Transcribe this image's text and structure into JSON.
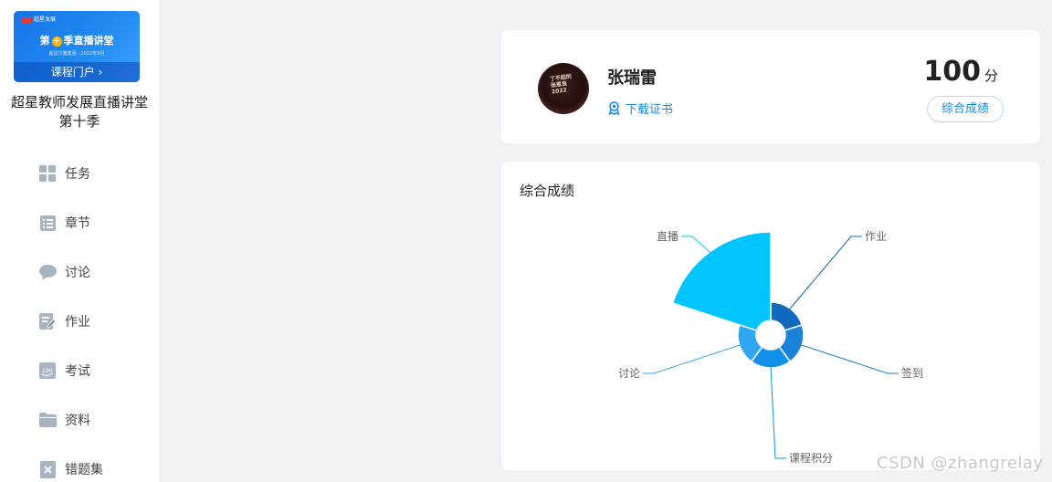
{
  "sidebar": {
    "banner": {
      "logo_text": "超星发展",
      "title_pre": "第",
      "title_num": "十",
      "title_post": "季直播讲堂",
      "subtitle": "超星尔雅集团 · 2022年9月",
      "portal_label": "课程门户 ›"
    },
    "course_title": "超星教师发展直播讲堂 第十季",
    "items": [
      {
        "label": "任务",
        "icon": "grid-icon"
      },
      {
        "label": "章节",
        "icon": "list-icon"
      },
      {
        "label": "讨论",
        "icon": "chat-icon"
      },
      {
        "label": "作业",
        "icon": "edit-icon"
      },
      {
        "label": "考试",
        "icon": "exam-icon"
      },
      {
        "label": "资料",
        "icon": "folder-icon"
      },
      {
        "label": "错题集",
        "icon": "error-book-icon"
      }
    ],
    "icon_color": "#a9b4c2"
  },
  "profile": {
    "name": "张瑞雷",
    "avatar_text": "了不起的\n张恩良\n2022",
    "cert_label": "下载证书",
    "score": "100",
    "score_unit": "分",
    "score_button": "综合成绩"
  },
  "chart_data": {
    "type": "pie",
    "title": "综合成绩",
    "rose": true,
    "categories": [
      "作业",
      "签到",
      "课程积分",
      "讨论",
      "直播"
    ],
    "values": [
      1,
      1.1,
      1.1,
      1.1,
      3
    ],
    "colors": [
      "#0f69bd",
      "#1a82d8",
      "#1190ea",
      "#2ea6f0",
      "#00c4ff"
    ]
  },
  "watermark": "CSDN @zhangrelay",
  "accent": "#1a8be6"
}
